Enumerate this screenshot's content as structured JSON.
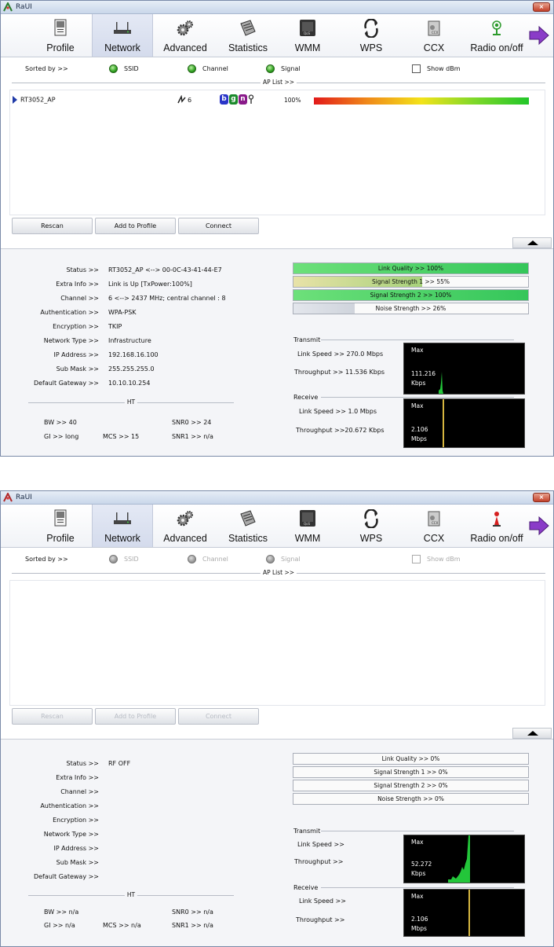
{
  "windows": [
    {
      "title": "RaUI",
      "close": "×",
      "toolbar": [
        "Profile",
        "Network",
        "Advanced",
        "Statistics",
        "WMM",
        "WPS",
        "CCX",
        "Radio on/off"
      ],
      "sort": {
        "label": "Sorted by >>",
        "ssid": "SSID",
        "channel": "Channel",
        "signal": "Signal",
        "show_dbm": "Show dBm"
      },
      "ap_list_label": "AP List >>",
      "ap": {
        "ssid": "RT3052_AP",
        "channel": "6",
        "badges": [
          "b",
          "g",
          "n"
        ],
        "signal": "100%",
        "signal_level": 1.0
      },
      "buttons": [
        "Rescan",
        "Add to Profile",
        "Connect"
      ],
      "info": [
        {
          "k": "Status >>",
          "v": "RT3052_AP <--> 00-0C-43-41-44-E7"
        },
        {
          "k": "Extra Info >>",
          "v": "Link is Up [TxPower:100%]"
        },
        {
          "k": "Channel >>",
          "v": "6 <--> 2437 MHz; central channel : 8"
        },
        {
          "k": "Authentication >>",
          "v": "WPA-PSK"
        },
        {
          "k": "Encryption >>",
          "v": "TKIP"
        },
        {
          "k": "Network Type >>",
          "v": "Infrastructure"
        },
        {
          "k": "IP Address >>",
          "v": "192.168.16.100"
        },
        {
          "k": "Sub Mask >>",
          "v": "255.255.255.0"
        },
        {
          "k": "Default Gateway >>",
          "v": "10.10.10.254"
        }
      ],
      "ht_label": "HT",
      "ht": {
        "bw": "BW >> 40",
        "gi": "GI >> long",
        "mcs": "MCS >>   15",
        "snr0": "SNR0 >>  24",
        "snr1": "SNR1 >>  n/a"
      },
      "bars": [
        {
          "label": "Link Quality >> 100%",
          "level": 1.0
        },
        {
          "label": "Signal Strength 1 >> 55%",
          "level": 0.55
        },
        {
          "label": "Signal Strength 2 >> 100%",
          "level": 1.0
        },
        {
          "label": "Noise Strength >> 26%",
          "level": 0.26
        }
      ],
      "transmit": {
        "label": "Transmit",
        "link_speed": "Link Speed >>  270.0 Mbps",
        "throughput": "Throughput >> 11.536 Kbps",
        "graph_max": "Max",
        "graph_value": "111.216",
        "graph_unit": "Kbps"
      },
      "receive": {
        "label": "Receive",
        "link_speed": "Link Speed >> 1.0 Mbps",
        "throughput": "Throughput >>20.672 Kbps",
        "graph_max": "Max",
        "graph_value": "2.106",
        "graph_unit": "Mbps"
      }
    },
    {
      "title": "RaUI",
      "close": "×",
      "toolbar": [
        "Profile",
        "Network",
        "Advanced",
        "Statistics",
        "WMM",
        "WPS",
        "CCX",
        "Radio on/off"
      ],
      "sort": {
        "label": "Sorted by >>",
        "ssid": "SSID",
        "channel": "Channel",
        "signal": "Signal",
        "show_dbm": "Show dBm"
      },
      "ap_list_label": "AP List >>",
      "buttons": [
        "Rescan",
        "Add to Profile",
        "Connect"
      ],
      "info": [
        {
          "k": "Status >>",
          "v": "RF OFF"
        },
        {
          "k": "Extra Info >>",
          "v": ""
        },
        {
          "k": "Channel >>",
          "v": ""
        },
        {
          "k": "Authentication >>",
          "v": ""
        },
        {
          "k": "Encryption >>",
          "v": ""
        },
        {
          "k": "Network Type >>",
          "v": ""
        },
        {
          "k": "IP Address >>",
          "v": ""
        },
        {
          "k": "Sub Mask >>",
          "v": ""
        },
        {
          "k": "Default Gateway >>",
          "v": ""
        }
      ],
      "ht_label": "HT",
      "ht": {
        "bw": "BW >> n/a",
        "gi": "GI >>  n/a",
        "mcs": "MCS >>   n/a",
        "snr0": "SNR0 >>  n/a",
        "snr1": "SNR1 >>  n/a"
      },
      "bars": [
        {
          "label": "Link Quality >> 0%",
          "level": 0
        },
        {
          "label": "Signal Strength 1 >> 0%",
          "level": 0
        },
        {
          "label": "Signal Strength 2 >> 0%",
          "level": 0
        },
        {
          "label": "Noise Strength >> 0%",
          "level": 0
        }
      ],
      "transmit": {
        "label": "Transmit",
        "link_speed": "Link Speed >>",
        "throughput": "Throughput >>",
        "graph_max": "Max",
        "graph_value": "52.272",
        "graph_unit": "Kbps"
      },
      "receive": {
        "label": "Receive",
        "link_speed": "Link Speed >>",
        "throughput": "Throughput >>",
        "graph_max": "Max",
        "graph_value": "2.106",
        "graph_unit": "Mbps"
      }
    }
  ]
}
